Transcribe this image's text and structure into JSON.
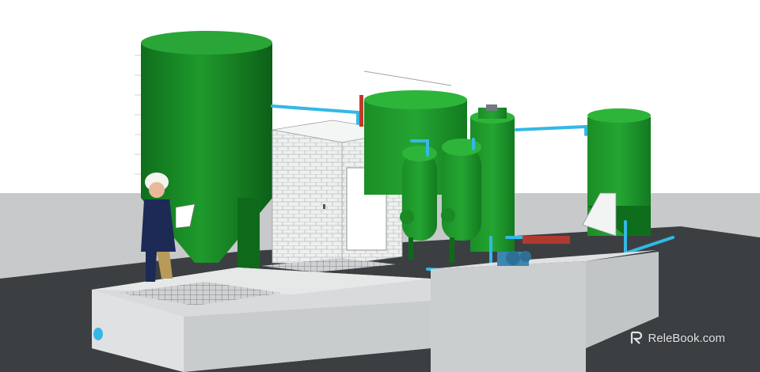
{
  "image": {
    "kind": "3D rendering of an industrial water treatment plant",
    "colors": {
      "sky": "#ffffff",
      "ground": "#c6c8c9",
      "floor": "#3b3f42",
      "tank": "#1f8a2a",
      "pipe": "#33b8e6",
      "concrete": "#d7d9da",
      "brick": "#eceeee"
    }
  },
  "watermark": {
    "text": "ReleBook.com",
    "icon": "relebook-logo-icon"
  }
}
